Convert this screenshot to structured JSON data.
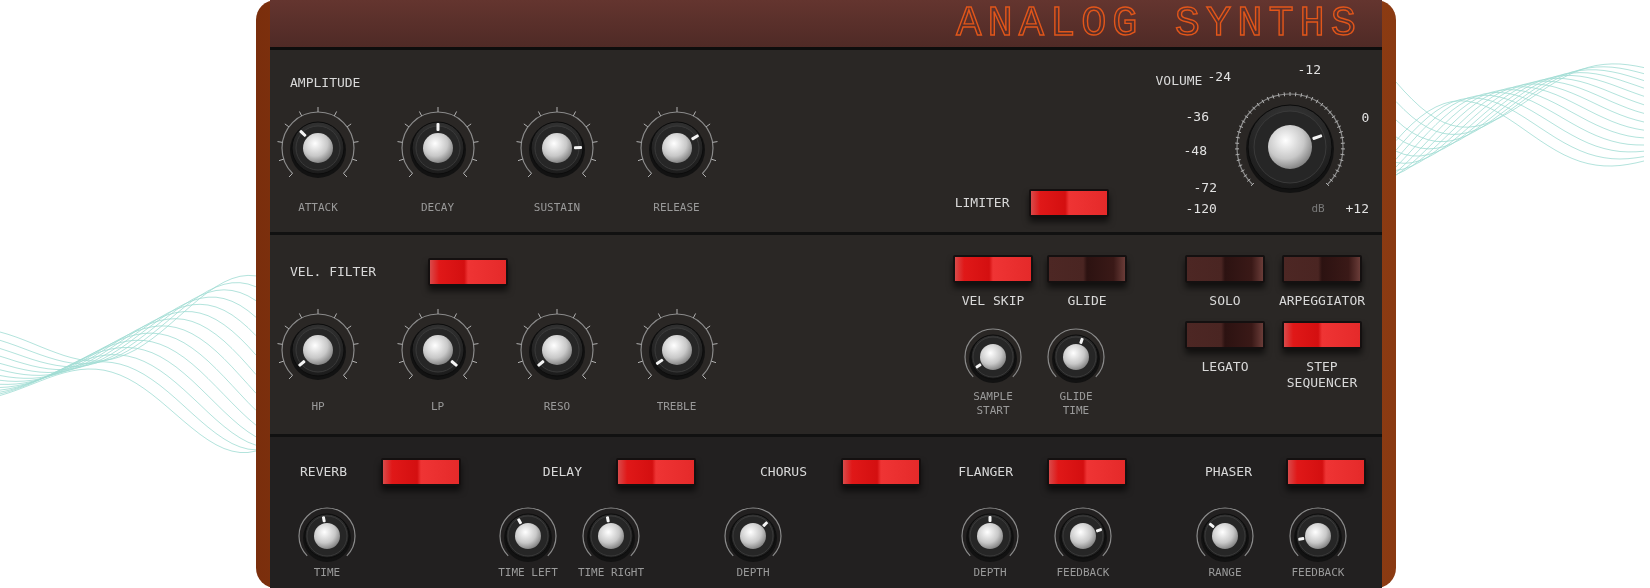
{
  "title": "ANALOG SYNTHS",
  "amplitude": {
    "label": "AMPLITUDE",
    "knobs": [
      {
        "label": "ATTACK",
        "level": 0.33
      },
      {
        "label": "DECAY",
        "level": 0.5
      },
      {
        "label": "SUSTAIN",
        "level": 0.83
      },
      {
        "label": "RELEASE",
        "level": 0.72
      }
    ]
  },
  "limiter": {
    "label": "LIMITER",
    "on": true
  },
  "volume": {
    "label": "VOLUME",
    "level": 0.76,
    "unit": "dB",
    "scale": [
      "-12",
      "-24",
      "-36",
      "0",
      "-48",
      "-72",
      "-120",
      "+12"
    ]
  },
  "filter": {
    "label": "VEL. FILTER",
    "on": true,
    "knobs": [
      {
        "label": "HP",
        "level": 0.02
      },
      {
        "label": "LP",
        "level": 0.98
      },
      {
        "label": "RESO",
        "level": 0.02
      },
      {
        "label": "TREBLE",
        "level": 0.04
      }
    ]
  },
  "switches": [
    {
      "label": "VEL SKIP",
      "on": true
    },
    {
      "label": "GLIDE",
      "on": false
    }
  ],
  "small_knobs": [
    {
      "label": "SAMPLE START",
      "level": 0.05
    },
    {
      "label": "GLIDE TIME",
      "level": 0.57
    }
  ],
  "modes": [
    {
      "label": "SOLO",
      "on": false
    },
    {
      "label": "ARPEGGIATOR",
      "on": false
    },
    {
      "label": "LEGATO",
      "on": false
    },
    {
      "label": "STEP SEQUENCER",
      "on": true
    }
  ],
  "effects": [
    {
      "name": "REVERB",
      "on": true,
      "knobs": [
        {
          "label": "TIME",
          "level": 0.46
        }
      ]
    },
    {
      "name": "DELAY",
      "on": true,
      "knobs": [
        {
          "label": "TIME LEFT",
          "level": 0.39
        },
        {
          "label": "TIME RIGHT",
          "level": 0.46
        }
      ]
    },
    {
      "name": "CHORUS",
      "on": true,
      "knobs": [
        {
          "label": "DEPTH",
          "level": 0.67
        }
      ]
    },
    {
      "name": "FLANGER",
      "on": true,
      "knobs": [
        {
          "label": "DEPTH",
          "level": 0.5
        },
        {
          "label": "FEEDBACK",
          "level": 0.76
        }
      ]
    },
    {
      "name": "PHASER",
      "on": true,
      "knobs": [
        {
          "label": "RANGE",
          "level": 0.31
        },
        {
          "label": "FEEDBACK",
          "level": 0.13
        }
      ]
    }
  ]
}
